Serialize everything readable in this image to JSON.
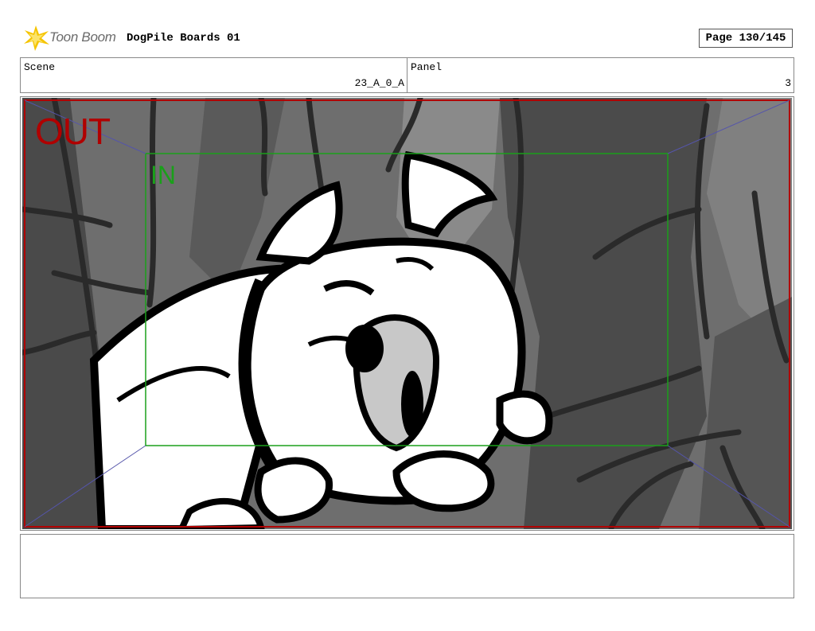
{
  "header": {
    "logo_text": "Toon Boom",
    "doc_title": "DogPile Boards 01",
    "page": "Page 130/145"
  },
  "scene": {
    "label": "Scene",
    "value": "23_A_0_A"
  },
  "panel": {
    "label": "Panel",
    "value": "3"
  },
  "frame": {
    "out_label": "OUT",
    "in_label": "IN"
  },
  "colors": {
    "out_frame": "#b00000",
    "in_frame": "#1aa01a",
    "border": "#888888"
  },
  "notes": {
    "text": ""
  }
}
